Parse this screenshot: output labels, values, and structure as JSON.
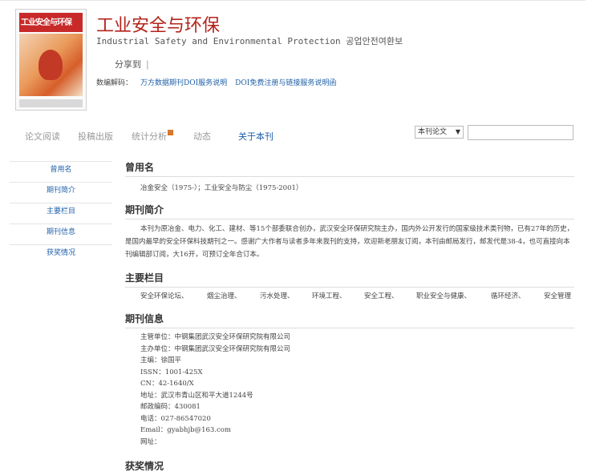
{
  "journal": {
    "cover_title": "工业安全与环保",
    "title": "工业安全与环保",
    "subtitle": "Industrial Safety and Environmental Protection 공업안전여환보",
    "share_label": "分享到",
    "share_separator": "|",
    "doi_label": "数编解码：",
    "doi_links": [
      "万方数据期刊DOI服务说明",
      "DOI免费注册与链接服务说明函"
    ]
  },
  "tabs": [
    "论文阅读",
    "投稿出版",
    "统计分析",
    "动态",
    "关于本刊"
  ],
  "tab_badge": "N",
  "search": {
    "select_value": "本刊论文"
  },
  "sidenav": [
    "曾用名",
    "期刊简介",
    "主要栏目",
    "期刊信息",
    "获奖情况"
  ],
  "sections": {
    "former_names": {
      "heading": "曾用名",
      "text": "冶金安全（1975-）；工业安全与防尘（1975-2001）"
    },
    "intro": {
      "heading": "期刊简介",
      "text": "本刊为原冶金、电力、化工、建材、等15个部委联合创办，武汉安全环保研究院主办，国内外公开发行的国家级技术类刊物，已有27年的历史，是国内最早的安全环保科技期刊之一。感谢广大作者与读者多年来我刊的支持，欢迎新老朋友订阅，本刊由邮局发行，邮发代是38-4，也可直接向本刊编辑部订阅，大16开，可预订全年合订本。"
    },
    "columns": {
      "heading": "主要栏目",
      "items": [
        "安全环保论坛、",
        "烟尘治理、",
        "污水处理、",
        "环境工程、",
        "安全工程、",
        "职业安全与健康、",
        "循环经济、",
        "安全管理"
      ]
    },
    "info": {
      "heading": "期刊信息",
      "lines": [
        "主管单位：中钢集团武汉安全环保研究院有限公司",
        "主办单位：中钢集团武汉安全环保研究院有限公司",
        "主编：徐国平",
        "ISSN：1001-425X",
        "CN：42-1640/X",
        "地址：武汉市青山区和平大道1244号",
        "邮政编码：430081",
        "电话：027-86547020",
        "Email：gyabhjb@163.com",
        "网址："
      ]
    },
    "awards": {
      "heading": "获奖情况"
    }
  },
  "colors": {
    "title": "#b3231c",
    "link": "#1e5fa8",
    "badge": "#e0701a"
  },
  "icons": {
    "search_select_caret": "caret-down-icon",
    "tab_badge": "new-badge-icon"
  }
}
